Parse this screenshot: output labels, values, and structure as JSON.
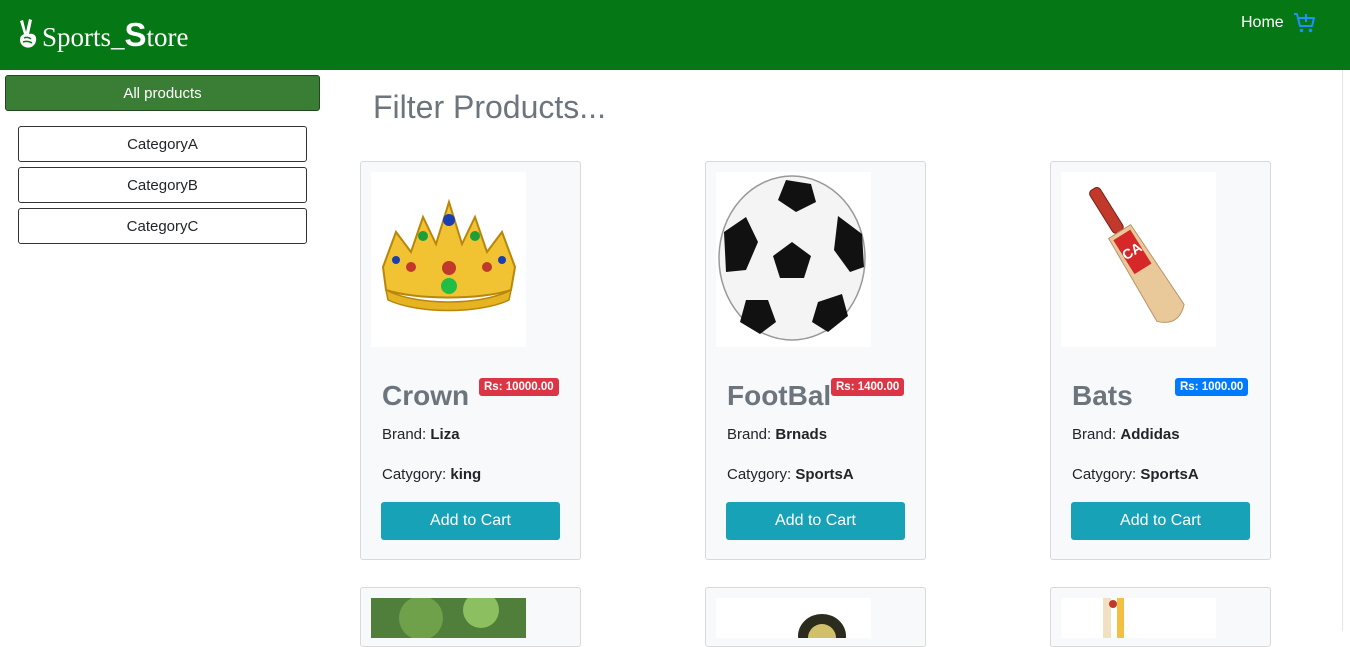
{
  "nav": {
    "brand_prefix": "Sports_",
    "brand_s": "S",
    "brand_suffix": "tore",
    "home_label": "Home",
    "cart_icon": "cart-icon",
    "logo_icon": "peace-hand-icon"
  },
  "sidebar": {
    "all_label": "All products",
    "categories": [
      {
        "label": "CategoryA"
      },
      {
        "label": "CategoryB"
      },
      {
        "label": "CategoryC"
      }
    ]
  },
  "main": {
    "heading": "Filter Products...",
    "products": [
      {
        "name": "Crown",
        "price": "Rs: 10000.00",
        "badge_color": "#dc3545",
        "brand_label": "Brand:",
        "brand": "Liza",
        "category_label": "Catygory:",
        "category": "king",
        "add_label": "Add to Cart",
        "image": "crown-image"
      },
      {
        "name": "FootBal",
        "price": "Rs: 1400.00",
        "badge_color": "#dc3545",
        "brand_label": "Brand:",
        "brand": "Brnads",
        "category_label": "Catygory:",
        "category": "SportsA",
        "add_label": "Add to Cart",
        "image": "football-image"
      },
      {
        "name": "Bats",
        "price": "Rs: 1000.00",
        "badge_color": "#007bff",
        "brand_label": "Brand:",
        "brand": "Addidas",
        "category_label": "Catygory:",
        "category": "SportsA",
        "add_label": "Add to Cart",
        "image": "cricket-bat-image"
      }
    ]
  },
  "colors": {
    "navbar": "#057715",
    "all_products": "#3a7d35",
    "add_to_cart": "#17a2b8",
    "badge_red": "#dc3545",
    "badge_blue": "#007bff"
  }
}
